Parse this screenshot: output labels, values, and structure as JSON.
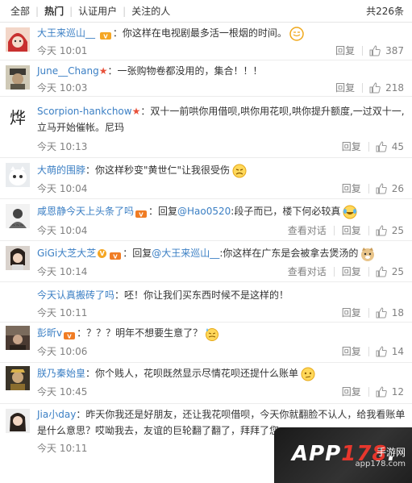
{
  "tabs": {
    "all": "全部",
    "hot": "热门",
    "verified": "认证用户",
    "following": "关注的人",
    "total": "共226条"
  },
  "actions": {
    "reply": "回复",
    "view_conversation": "查看对话"
  },
  "comments": [
    {
      "user": "大王来巡山__",
      "text": "：你这样在电视剧最多活一根烟的时间。",
      "time": "今天 10:01",
      "likes": "387"
    },
    {
      "user": "June__Chang",
      "text": "：一张购物卷都没用的，集合！！！",
      "time": "今天 10:03",
      "likes": "218"
    },
    {
      "user": "Scorpion-hankchow",
      "text": "：双十一前哄你用借呗,哄你用花呗,哄你提升额度,一过双十一,",
      "text2": "立马开始催帐。尼玛",
      "time": "今天 10:13",
      "likes": "45"
    },
    {
      "user": "大萌的围脖",
      "text": "：你这样秒变\"黄世仁\"让我很受伤",
      "time": "今天 10:04",
      "likes": "26"
    },
    {
      "user": "咸恩静今天上头条了吗",
      "text_pre": "：回复",
      "mention": "@Hao0520",
      "text": ":段子而已，楼下何必较真",
      "time": "今天 10:04",
      "likes": "25"
    },
    {
      "user": "GiGi大芝大芝",
      "text_pre": "：回复",
      "mention": "@大王来巡山__",
      "text": ":你这样在广东是会被拿去煲汤的",
      "time": "今天 10:14",
      "likes": "25"
    },
    {
      "user": "今天认真搬砖了吗",
      "text": "：呸！你让我们买东西时候不是这样的！",
      "time": "今天 10:11",
      "likes": "18"
    },
    {
      "user": "彭昕v",
      "text": "：？？？明年不想要生意了？",
      "time": "今天 10:06",
      "likes": "14"
    },
    {
      "user": "朕乃秦始皇",
      "text": "：你个贱人，花呗既然显示尽情花呗还提什么账单",
      "time": "今天 10:45",
      "likes": "12"
    },
    {
      "user": "Jia小day",
      "text": "：昨天你我还是好朋友，还让我花呗借呗，今天你就翻脸不认人，给我看账单",
      "text2": "是什么意思？哎呦我去，友谊的巨轮翻了翻了，拜拜了您",
      "time": "今天 10:11",
      "likes": ""
    }
  ],
  "watermark": {
    "brand_a": "APP",
    "brand_num": "178",
    "brand_dot": ".",
    "sub": "手游网",
    "sub2": "app178.com"
  },
  "colors": {
    "username": "#eb7350",
    "link": "#3b7fc4",
    "meta": "#808080",
    "watermark_bg": "#1a1a1a",
    "watermark_accent": "#e7372d"
  }
}
